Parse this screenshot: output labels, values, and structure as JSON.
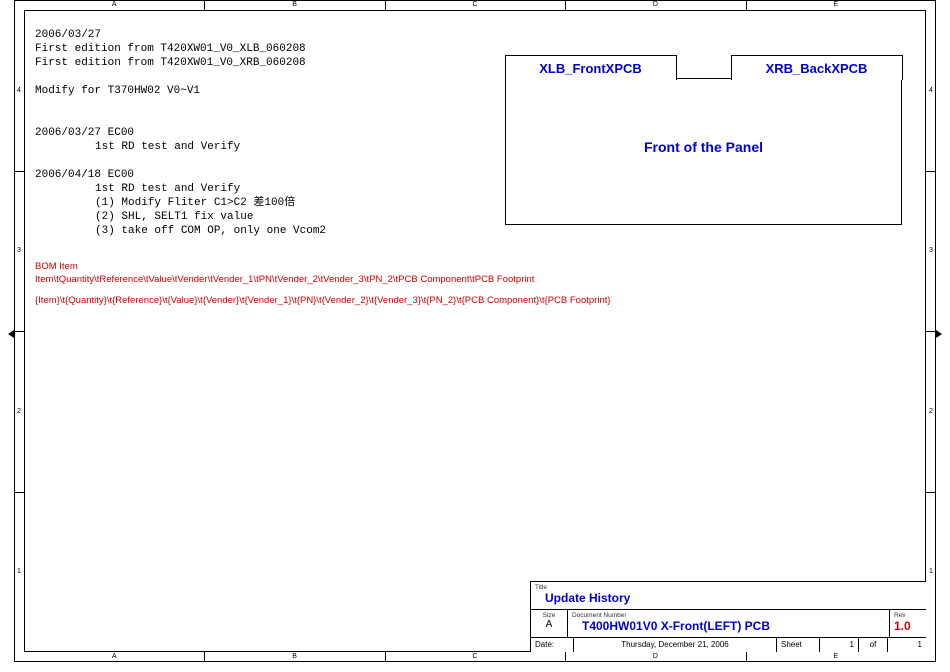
{
  "ruler": {
    "cols": [
      "A",
      "B",
      "C",
      "D",
      "E"
    ],
    "rows_left": [
      "4",
      "3",
      "2",
      "1"
    ],
    "rows_right": [
      "4",
      "3",
      "2",
      "1"
    ]
  },
  "notes": {
    "l1": "2006/03/27",
    "l2": "First edition from T420XW01_V0_XLB_060208",
    "l3": "First edition from T420XW01_V0_XRB_060208",
    "l4": "Modify for T370HW02 V0~V1",
    "l5": "2006/03/27 EC00",
    "l6": "1st RD test and Verify",
    "l7": "2006/04/18 EC00",
    "l8": "1st RD test and Verify",
    "l9": "(1) Modify Fliter C1>C2 差100倍",
    "l10": "(2) SHL, SELT1 fix value",
    "l11": "(3) take off COM OP, only one Vcom2"
  },
  "bom": {
    "l1": "BOM Item",
    "l2": "Item\\tQuantity\\tReference\\tValue\\tVender\\tVender_1\\tPN\\tVender_2\\tVender_3\\tPN_2\\tPCB Component\\tPCB Footprint",
    "l3": "{Item}\\t{Quantity}\\t{Reference}\\t{Value}\\t{Vender}\\t{Vender_1}\\t{PN}\\t{Vender_2}\\t{Vender_3}\\t{PN_2}\\t{PCB Component}\\t{PCB Footprint}"
  },
  "panel": {
    "tab_left": "XLB_FrontXPCB",
    "tab_right": "XRB_BackXPCB",
    "label": "Front of the Panel"
  },
  "title_block": {
    "title_label": "Title",
    "title": "Update History",
    "size_label": "Size",
    "size": "A",
    "docnum_label": "Document Number",
    "docnum": "T400HW01V0 X-Front(LEFT) PCB",
    "rev_label": "Rev",
    "rev": "1.0",
    "date_label": "Date:",
    "date": "Thursday, December 21, 2006",
    "sheet_label": "Sheet",
    "sheet_cur": "1",
    "sheet_of": "of",
    "sheet_tot": "1"
  }
}
